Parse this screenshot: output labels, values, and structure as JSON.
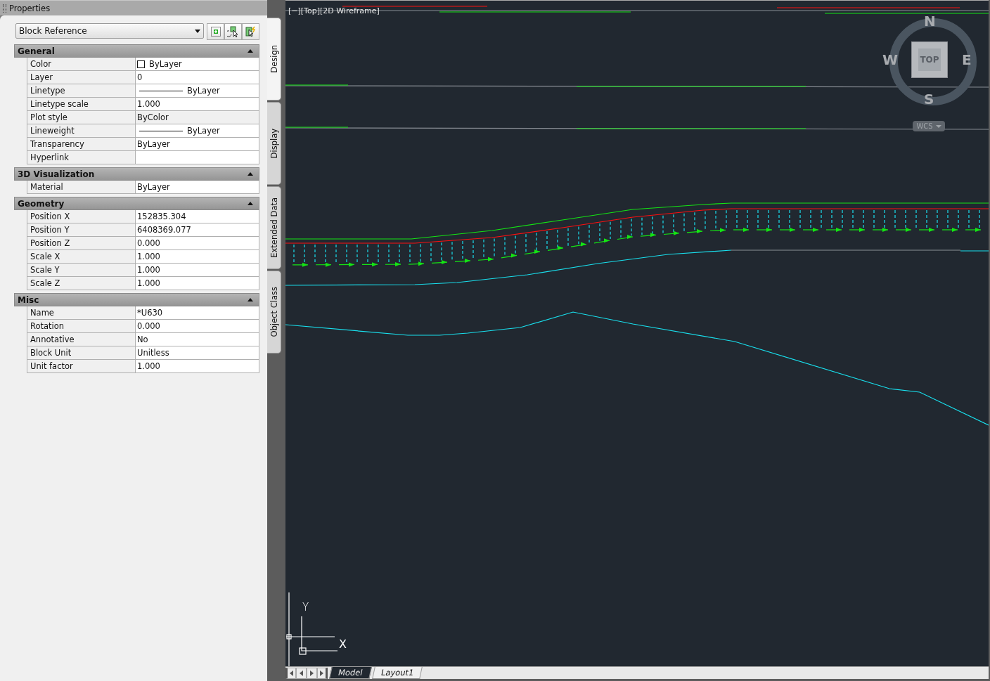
{
  "palette": {
    "title": "Properties",
    "object_type": "Block Reference",
    "sections": [
      {
        "title": "General",
        "expanded": true,
        "rows": [
          {
            "label": "Color",
            "value": "ByLayer",
            "kind": "color"
          },
          {
            "label": "Layer",
            "value": "0",
            "kind": "text"
          },
          {
            "label": "Linetype",
            "value": "ByLayer",
            "kind": "line"
          },
          {
            "label": "Linetype scale",
            "value": "1.000",
            "kind": "text"
          },
          {
            "label": "Plot style",
            "value": "ByColor",
            "kind": "text",
            "disabled": true
          },
          {
            "label": "Lineweight",
            "value": "ByLayer",
            "kind": "line"
          },
          {
            "label": "Transparency",
            "value": "ByLayer",
            "kind": "text"
          },
          {
            "label": "Hyperlink",
            "value": "",
            "kind": "text"
          }
        ]
      },
      {
        "title": "3D Visualization",
        "expanded": true,
        "rows": [
          {
            "label": "Material",
            "value": "ByLayer",
            "kind": "text"
          }
        ]
      },
      {
        "title": "Geometry",
        "expanded": true,
        "rows": [
          {
            "label": "Position X",
            "value": "152835.304",
            "kind": "text"
          },
          {
            "label": "Position Y",
            "value": "6408369.077",
            "kind": "text"
          },
          {
            "label": "Position Z",
            "value": "0.000",
            "kind": "text"
          },
          {
            "label": "Scale X",
            "value": "1.000",
            "kind": "text"
          },
          {
            "label": "Scale Y",
            "value": "1.000",
            "kind": "text"
          },
          {
            "label": "Scale Z",
            "value": "1.000",
            "kind": "text"
          }
        ]
      },
      {
        "title": "Misc",
        "expanded": true,
        "rows": [
          {
            "label": "Name",
            "value": "*U630",
            "kind": "text"
          },
          {
            "label": "Rotation",
            "value": "0.000",
            "kind": "text"
          },
          {
            "label": "Annotative",
            "value": "No",
            "kind": "text"
          },
          {
            "label": "Block Unit",
            "value": "Unitless",
            "kind": "text"
          },
          {
            "label": "Unit factor",
            "value": "1.000",
            "kind": "text"
          }
        ]
      }
    ],
    "side_tabs": [
      {
        "label": "Design",
        "selected": true
      },
      {
        "label": "Display",
        "selected": false
      },
      {
        "label": "Extended Data",
        "selected": false
      },
      {
        "label": "Object Class",
        "selected": false
      }
    ]
  },
  "viewport": {
    "label": "[−][Top][2D Wireframe]",
    "viewcube": {
      "north": "N",
      "east": "E",
      "south": "S",
      "west": "W",
      "face": "TOP",
      "coordinate_system": "WCS"
    },
    "ucs": {
      "x": "X",
      "y": "Y"
    },
    "layout_tabs": [
      {
        "label": "Model",
        "selected": true
      },
      {
        "label": "Layout1",
        "selected": false
      }
    ]
  }
}
